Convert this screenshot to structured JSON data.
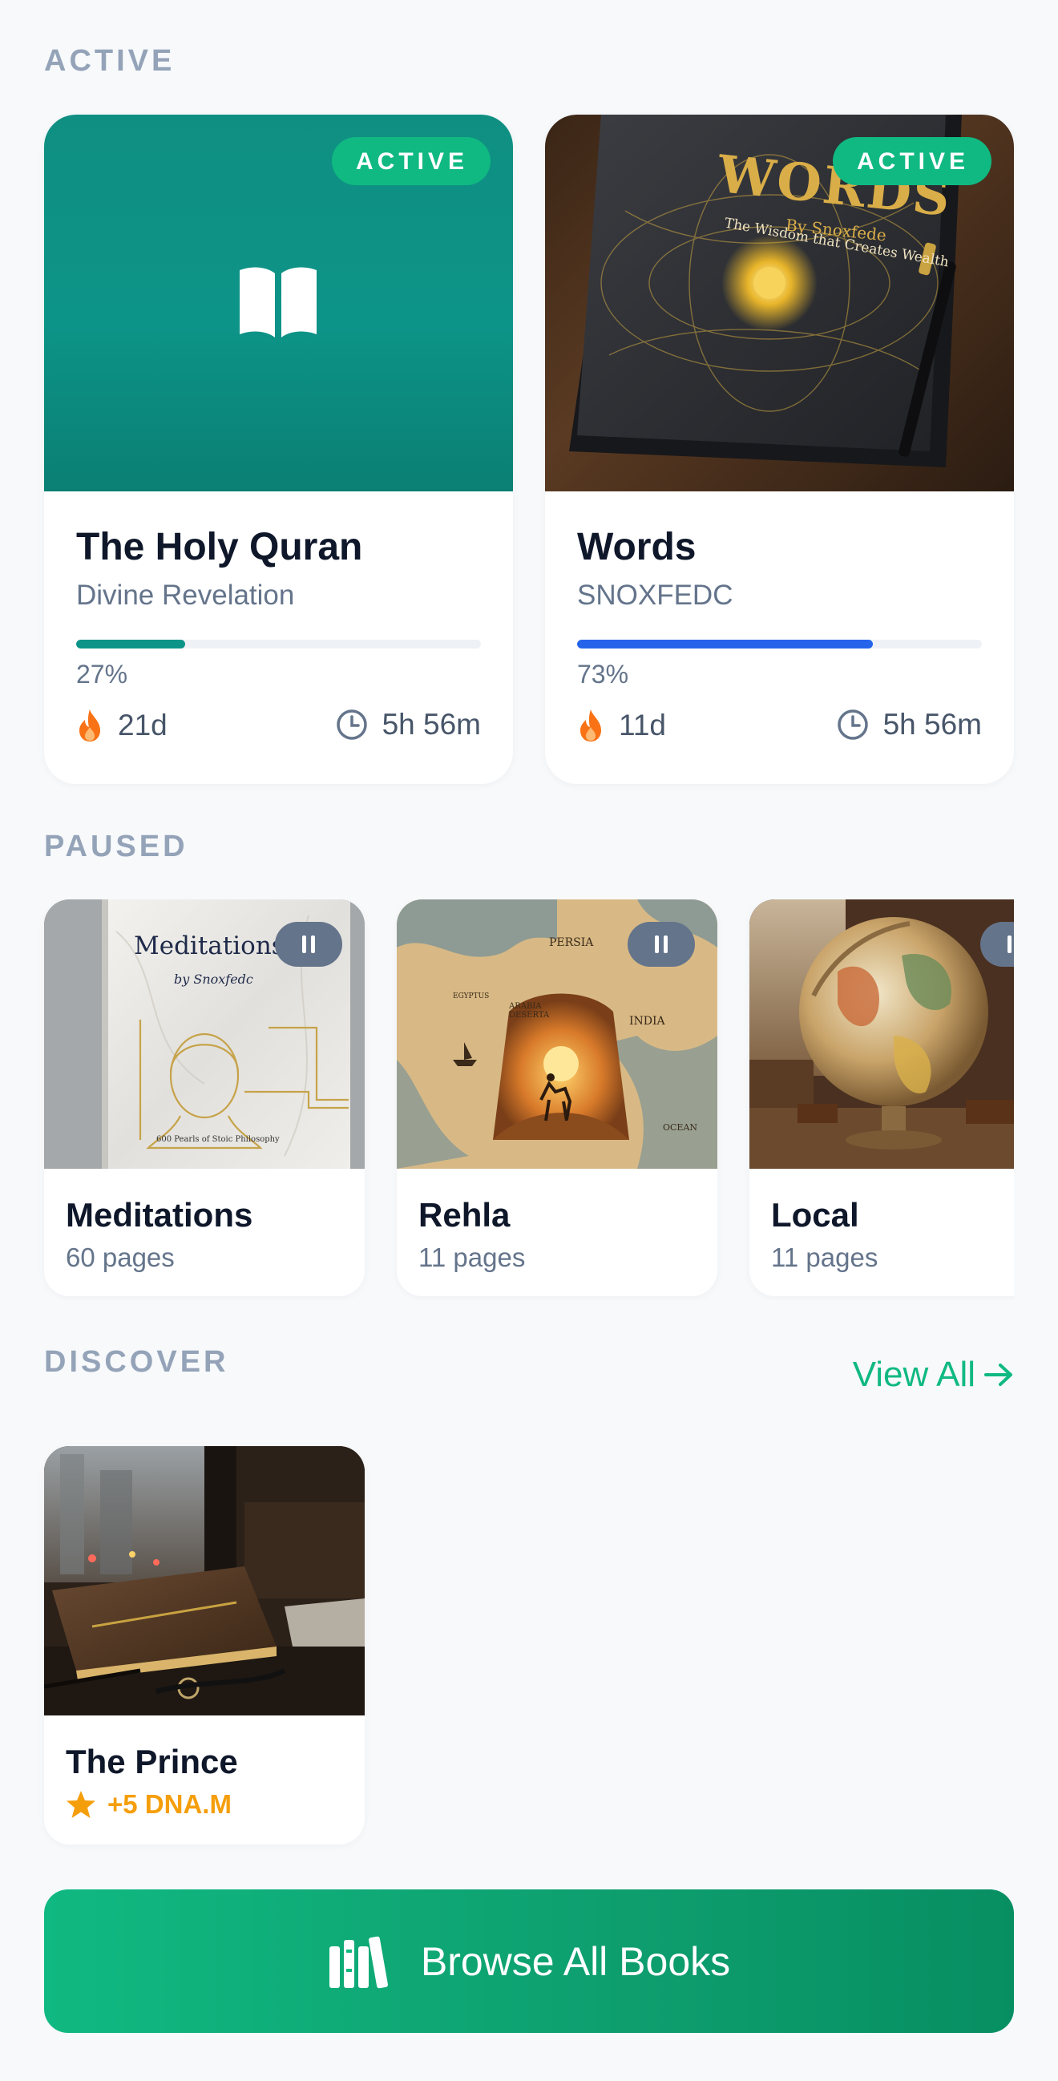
{
  "sections": {
    "active": "ACTIVE",
    "paused": "PAUSED",
    "discover": "DISCOVER"
  },
  "active_books": [
    {
      "title": "The Holy Quran",
      "author": "Divine Revelation",
      "badge": "ACTIVE",
      "progress": 27,
      "progress_label": "27%",
      "progress_color": "#0d9488",
      "streak": "21d",
      "time": "5h 56m",
      "cover": "book-open-icon"
    },
    {
      "title": "Words",
      "author": "SNOXFEDC",
      "badge": "ACTIVE",
      "progress": 73,
      "progress_label": "73%",
      "progress_color": "#2563eb",
      "streak": "11d",
      "time": "5h 56m",
      "cover": "book-cover-words",
      "cover_text": {
        "title": "WORDS",
        "byline": "By Snoxfede",
        "subtitle": "The Wisdom that Creates Wealth"
      }
    }
  ],
  "paused_books": [
    {
      "title": "Meditations",
      "pages": "60 pages",
      "cover_text": {
        "title": "Meditations.",
        "byline": "by Snoxfedc",
        "subtitle": "600 Pearls of Stoic Philosophy"
      }
    },
    {
      "title": "Rehla",
      "pages": "11 pages",
      "cover_text": {
        "persia": "PERSIA",
        "arabia": "ARABIA DESERTA",
        "india": "INDIA",
        "egyptus": "EGYPTUS",
        "ocean": "OCEAN"
      }
    },
    {
      "title": "Local",
      "pages": "11 pages"
    }
  ],
  "discover": {
    "view_all": "View All",
    "books": [
      {
        "title": "The Prince",
        "reward": "+5 DNA.M"
      }
    ]
  },
  "browse_button": "Browse All Books",
  "colors": {
    "accent": "#10b981",
    "teal_cover": "#0f8f82",
    "muted": "#94a3b8",
    "flame": "#f97316",
    "star": "#f59e0b"
  }
}
